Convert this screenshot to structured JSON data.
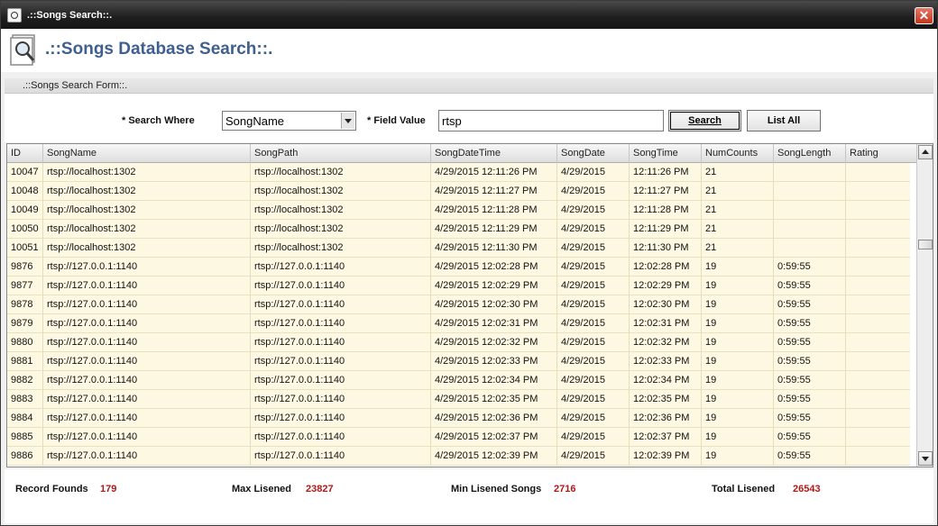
{
  "window": {
    "title": ".::Songs Search::."
  },
  "header": {
    "title": ".::Songs Database Search::."
  },
  "section": {
    "label": ".::Songs Search Form::."
  },
  "form": {
    "search_where_label": "* Search Where",
    "search_where_value": "SongName",
    "field_value_label": "* Field Value",
    "field_value": "rtsp",
    "search_button": "Search",
    "list_all_button": "List All"
  },
  "grid": {
    "columns": [
      "ID",
      "SongName",
      "SongPath",
      "SongDateTime",
      "SongDate",
      "SongTime",
      "NumCounts",
      "SongLength",
      "Rating"
    ],
    "rows": [
      [
        "10047",
        "rtsp://localhost:1302",
        "rtsp://localhost:1302",
        "4/29/2015 12:11:26 PM",
        "4/29/2015",
        "12:11:26 PM",
        "21",
        "",
        ""
      ],
      [
        "10048",
        "rtsp://localhost:1302",
        "rtsp://localhost:1302",
        "4/29/2015 12:11:27 PM",
        "4/29/2015",
        "12:11:27 PM",
        "21",
        "",
        ""
      ],
      [
        "10049",
        "rtsp://localhost:1302",
        "rtsp://localhost:1302",
        "4/29/2015 12:11:28 PM",
        "4/29/2015",
        "12:11:28 PM",
        "21",
        "",
        ""
      ],
      [
        "10050",
        "rtsp://localhost:1302",
        "rtsp://localhost:1302",
        "4/29/2015 12:11:29 PM",
        "4/29/2015",
        "12:11:29 PM",
        "21",
        "",
        ""
      ],
      [
        "10051",
        "rtsp://localhost:1302",
        "rtsp://localhost:1302",
        "4/29/2015 12:11:30 PM",
        "4/29/2015",
        "12:11:30 PM",
        "21",
        "",
        ""
      ],
      [
        "9876",
        "rtsp://127.0.0.1:1140",
        "rtsp://127.0.0.1:1140",
        "4/29/2015 12:02:28 PM",
        "4/29/2015",
        "12:02:28 PM",
        "19",
        "0:59:55",
        ""
      ],
      [
        "9877",
        "rtsp://127.0.0.1:1140",
        "rtsp://127.0.0.1:1140",
        "4/29/2015 12:02:29 PM",
        "4/29/2015",
        "12:02:29 PM",
        "19",
        "0:59:55",
        ""
      ],
      [
        "9878",
        "rtsp://127.0.0.1:1140",
        "rtsp://127.0.0.1:1140",
        "4/29/2015 12:02:30 PM",
        "4/29/2015",
        "12:02:30 PM",
        "19",
        "0:59:55",
        ""
      ],
      [
        "9879",
        "rtsp://127.0.0.1:1140",
        "rtsp://127.0.0.1:1140",
        "4/29/2015 12:02:31 PM",
        "4/29/2015",
        "12:02:31 PM",
        "19",
        "0:59:55",
        ""
      ],
      [
        "9880",
        "rtsp://127.0.0.1:1140",
        "rtsp://127.0.0.1:1140",
        "4/29/2015 12:02:32 PM",
        "4/29/2015",
        "12:02:32 PM",
        "19",
        "0:59:55",
        ""
      ],
      [
        "9881",
        "rtsp://127.0.0.1:1140",
        "rtsp://127.0.0.1:1140",
        "4/29/2015 12:02:33 PM",
        "4/29/2015",
        "12:02:33 PM",
        "19",
        "0:59:55",
        ""
      ],
      [
        "9882",
        "rtsp://127.0.0.1:1140",
        "rtsp://127.0.0.1:1140",
        "4/29/2015 12:02:34 PM",
        "4/29/2015",
        "12:02:34 PM",
        "19",
        "0:59:55",
        ""
      ],
      [
        "9883",
        "rtsp://127.0.0.1:1140",
        "rtsp://127.0.0.1:1140",
        "4/29/2015 12:02:35 PM",
        "4/29/2015",
        "12:02:35 PM",
        "19",
        "0:59:55",
        ""
      ],
      [
        "9884",
        "rtsp://127.0.0.1:1140",
        "rtsp://127.0.0.1:1140",
        "4/29/2015 12:02:36 PM",
        "4/29/2015",
        "12:02:36 PM",
        "19",
        "0:59:55",
        ""
      ],
      [
        "9885",
        "rtsp://127.0.0.1:1140",
        "rtsp://127.0.0.1:1140",
        "4/29/2015 12:02:37 PM",
        "4/29/2015",
        "12:02:37 PM",
        "19",
        "0:59:55",
        ""
      ],
      [
        "9886",
        "rtsp://127.0.0.1:1140",
        "rtsp://127.0.0.1:1140",
        "4/29/2015 12:02:39 PM",
        "4/29/2015",
        "12:02:39 PM",
        "19",
        "0:59:55",
        ""
      ]
    ]
  },
  "footer": {
    "record_founds_label": "Record Founds",
    "record_founds_value": "179",
    "max_listened_label": "Max Lisened",
    "max_listened_value": "23827",
    "min_listened_label": "Min Lisened Songs",
    "min_listened_value": "2716",
    "total_listened_label": "Total Lisened",
    "total_listened_value": "26543"
  },
  "colors": {
    "title_accent": "#3f5f8f",
    "row_background": "#fdf8e2",
    "footer_value": "#b01818",
    "close_button": "#c2351f"
  },
  "icons": {
    "window": "search-document-icon",
    "close": "close-icon",
    "header": "magnifier-document-icon"
  }
}
